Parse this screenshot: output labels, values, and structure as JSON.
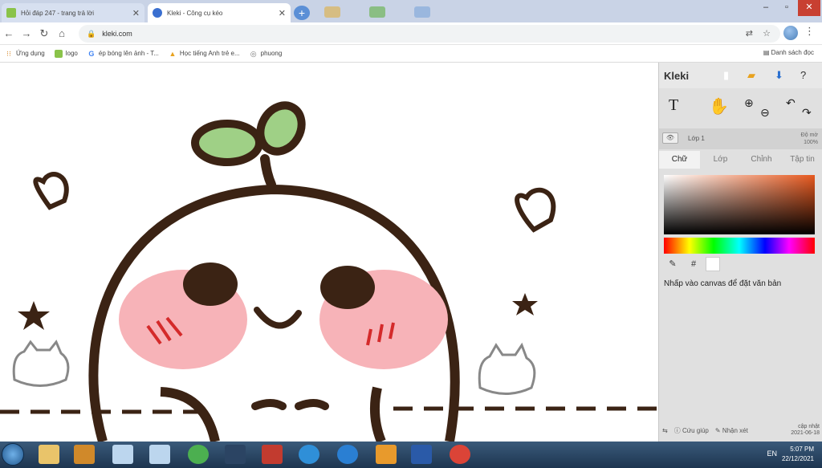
{
  "tabs": [
    {
      "title": "Hỏi đáp 247 - trang trả lời",
      "favicon_color": "#8ac34a"
    },
    {
      "title": "Kleki - Công cụ kéo",
      "favicon_color": "#3a6fd0"
    }
  ],
  "address": {
    "url": "kleki.com"
  },
  "bookmarks": [
    {
      "label": "Ứng dụng",
      "icon": "apps-grid-icon",
      "color": "#d68a2e"
    },
    {
      "label": "logo",
      "icon": "h-logo-icon",
      "color": "#8ac34a"
    },
    {
      "label": "ép bóng lên ảnh - T...",
      "icon": "google-g-icon",
      "color": "#4285f4"
    },
    {
      "label": "Học tiếng Anh trẻ e...",
      "icon": "warning-triangle-icon",
      "color": "#e8a21f"
    },
    {
      "label": "phuong",
      "icon": "circle-icon",
      "color": "#777777"
    }
  ],
  "reading_list": "Danh sách đọc",
  "panel": {
    "logo": "Kleki",
    "layer": {
      "name": "Lớp 1",
      "opacity_label": "Độ mờ",
      "opacity_value": "100%"
    },
    "tabs": [
      "Chữ",
      "Lớp",
      "Chỉnh",
      "Tập tin"
    ],
    "hint": "Nhấp vào canvas để đặt văn bản",
    "footer": {
      "help": "Cứu giúp",
      "feedback": "Nhận xét",
      "update_label": "cập nhật",
      "update_date": "2021-06-18"
    }
  },
  "taskbar": {
    "tray_lang": "EN",
    "time": "5:07 PM",
    "date": "22/12/2021",
    "apps": [
      {
        "name": "explorer-icon",
        "color": "#e9c46a"
      },
      {
        "name": "media-icon",
        "color": "#d0892a"
      },
      {
        "name": "notepad-icon",
        "color": "#bcd6ee"
      },
      {
        "name": "chrome-icon",
        "color": "#4caf50"
      },
      {
        "name": "pdf-icon",
        "color": "#2b4463"
      },
      {
        "name": "snip-icon",
        "color": "#c23b2f"
      },
      {
        "name": "teamviewer-icon",
        "color": "#2f8fd8"
      },
      {
        "name": "ie-icon",
        "color": "#2a7fd3"
      },
      {
        "name": "yellow-app-icon",
        "color": "#e89a2c"
      },
      {
        "name": "word-icon",
        "color": "#2a5aa8"
      },
      {
        "name": "chrome-active-icon",
        "color": "#db4437"
      }
    ]
  },
  "colors": {
    "accent": "#3a6fd0",
    "panel_bg": "#e0e0e0",
    "taskbar": "#1d3550"
  }
}
